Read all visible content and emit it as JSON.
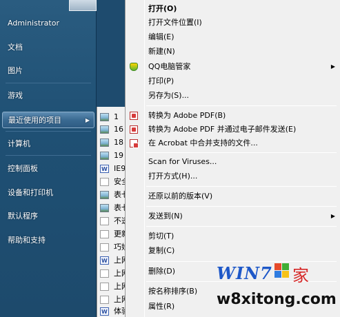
{
  "start_menu": {
    "items": [
      {
        "label": "Administrator"
      },
      {
        "label": "文档"
      },
      {
        "label": "图片"
      },
      {
        "label": "游戏"
      },
      {
        "label": "最近使用的项目",
        "active": true,
        "arrow": "▶"
      },
      {
        "label": "计算机"
      },
      {
        "label": "控制面板"
      },
      {
        "label": "设备和打印机"
      },
      {
        "label": "默认程序"
      },
      {
        "label": "帮助和支持"
      }
    ]
  },
  "recent_items": [
    {
      "label": "1",
      "icon": "image-file-icon"
    },
    {
      "label": "16",
      "icon": "image-file-icon"
    },
    {
      "label": "18",
      "icon": "image-file-icon"
    },
    {
      "label": "19",
      "icon": "image-file-icon"
    },
    {
      "label": "IE9",
      "icon": "word-document-icon"
    },
    {
      "label": "安全",
      "icon": "file-icon"
    },
    {
      "label": "表七",
      "icon": "image-file-icon"
    },
    {
      "label": "表七",
      "icon": "image-file-icon"
    },
    {
      "label": "不透",
      "icon": "file-icon"
    },
    {
      "label": "更新",
      "icon": "file-icon"
    },
    {
      "label": "巧妙",
      "icon": "file-icon"
    },
    {
      "label": "上网",
      "icon": "word-document-icon"
    },
    {
      "label": "上网",
      "icon": "text-file-icon"
    },
    {
      "label": "上网",
      "icon": "file-icon"
    },
    {
      "label": "上网",
      "icon": "file-icon"
    },
    {
      "label": "体验",
      "icon": "word-document-icon"
    }
  ],
  "context_menu": {
    "items": [
      {
        "label": "打开(O)",
        "bold": true
      },
      {
        "label": "打开文件位置(I)"
      },
      {
        "label": "编辑(E)"
      },
      {
        "label": "新建(N)"
      },
      {
        "label": "QQ电脑管家",
        "icon": "qq-shield-icon",
        "submenu": true
      },
      {
        "label": "打印(P)"
      },
      {
        "label": "另存为(S)..."
      },
      {
        "label": "转换为 Adobe PDF(B)",
        "icon": "pdf-icon"
      },
      {
        "label": "转换为 Adobe PDF 并通过电子邮件发送(E)",
        "icon": "pdf-icon"
      },
      {
        "label": "在 Acrobat 中合并支持的文件...",
        "icon": "pdf-combine-icon"
      },
      {
        "label": "Scan for Viruses..."
      },
      {
        "label": "打开方式(H)..."
      },
      {
        "label": "还原以前的版本(V)"
      },
      {
        "label": "发送到(N)",
        "submenu": true
      },
      {
        "label": "剪切(T)"
      },
      {
        "label": "复制(C)"
      },
      {
        "label": "删除(D)"
      },
      {
        "label": "按名称排序(B)"
      },
      {
        "label": "属性(R)"
      }
    ],
    "submenu_arrow": "▶"
  },
  "watermark": {
    "logo": "WIN7",
    "suffix": "家",
    "site": "w8xitong.com"
  }
}
